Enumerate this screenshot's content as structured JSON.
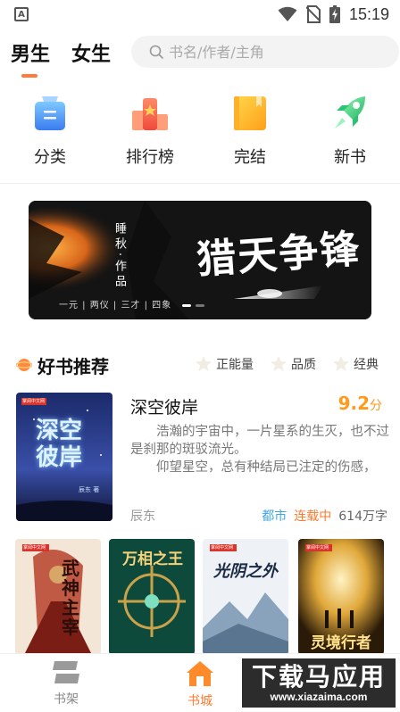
{
  "status_bar": {
    "notification_letter": "A",
    "time": "15:19",
    "icons": [
      "wifi-icon",
      "no-sim-icon",
      "battery-charging-icon"
    ]
  },
  "header": {
    "tabs": [
      {
        "label": "男生",
        "active": true
      },
      {
        "label": "女生",
        "active": false
      }
    ],
    "search_placeholder": "书名/作者/主角"
  },
  "categories": [
    {
      "label": "分类",
      "icon": "category-icon"
    },
    {
      "label": "排行榜",
      "icon": "ranking-icon"
    },
    {
      "label": "完结",
      "icon": "completed-book-icon"
    },
    {
      "label": "新书",
      "icon": "rocket-icon"
    }
  ],
  "banner": {
    "author": "睡秋·作品",
    "title": "猎天争锋",
    "tagline": "一元 | 两仪 | 三才 | 四象",
    "page_count": 2,
    "active_page": 1
  },
  "section": {
    "title": "好书推荐",
    "filters": [
      "正能量",
      "品质",
      "经典"
    ]
  },
  "featured_book": {
    "cover_title": "深空彼岸",
    "cover_author": "辰东 著",
    "cover_badge": "掌阅中文网",
    "title": "深空彼岸",
    "score": "9.2",
    "score_unit": "分",
    "desc_lines": [
      "浩瀚的宇宙中，一片星系的生灭，也不过是刹那的斑驳流光。",
      "仰望星空，总有种结局已注定的伤感，"
    ],
    "author": "辰东",
    "genre": "都市",
    "status": "连载中",
    "word_count": "614万字"
  },
  "grid_books": [
    {
      "cover_title": "武神主宰",
      "badge": "掌阅中文网"
    },
    {
      "cover_title": "万相之王",
      "badge": ""
    },
    {
      "cover_title": "光阴之外",
      "badge": "掌阅中文网"
    },
    {
      "cover_title": "灵境行者",
      "badge": "掌阅中文网"
    }
  ],
  "bottom_nav": [
    {
      "label": "书架",
      "icon": "bookshelf-icon",
      "active": false
    },
    {
      "label": "书城",
      "icon": "home-icon",
      "active": true
    }
  ],
  "watermark": {
    "main": "下载马应用",
    "sub": "www.xiazaima.com"
  },
  "colors": {
    "accent": "#ff7a3d",
    "score": "#ff9a1a",
    "genre": "#3fa6e8",
    "status": "#ff7a2d"
  }
}
